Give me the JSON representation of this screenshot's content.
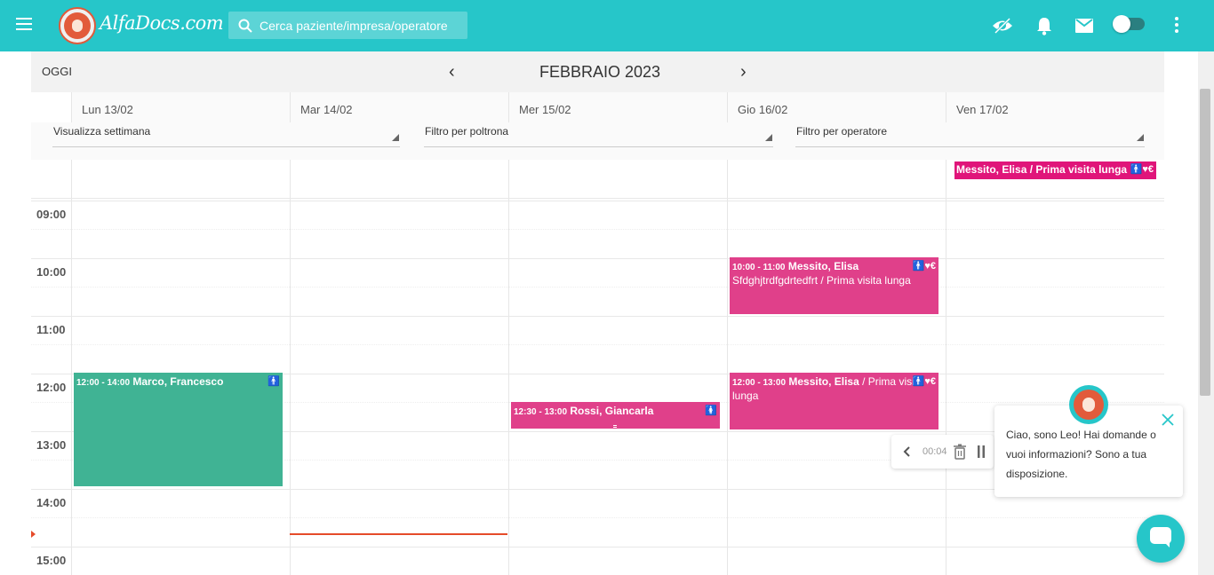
{
  "header": {
    "brand": "AlfaDocs.com",
    "search_placeholder": "Cerca paziente/impresa/operatore"
  },
  "calendar": {
    "today_label": "OGGI",
    "prev_label": "‹",
    "next_label": "›",
    "month_label": "FEBBRAIO 2023",
    "days": [
      "Lun 13/02",
      "Mar 14/02",
      "Mer 15/02",
      "Gio 16/02",
      "Ven 17/02"
    ],
    "filters": {
      "view": "Visualizza settimana",
      "chair": "Filtro per poltrona",
      "operator": "Filtro per operatore"
    },
    "hours": [
      "09:00",
      "10:00",
      "11:00",
      "12:00",
      "13:00",
      "14:00",
      "15:00"
    ],
    "allday_event": {
      "title": "Messito, Elisa / Prima visita lunga",
      "icons": "🚹♥€"
    },
    "events": [
      {
        "time": "10:00 - 11:00",
        "name": "Messito, Elisa",
        "detail": "Sfdghjtrdfgdrtedfrt / Prima visita lunga",
        "icons": "🚹♥€"
      },
      {
        "time": "12:00 - 14:00",
        "name": "Marco, Francesco",
        "detail": "",
        "icons": "🚹"
      },
      {
        "time": "12:30 - 13:00",
        "name": "Rossi, Giancarla",
        "detail": "",
        "icons": "🚺"
      },
      {
        "time": "12:00 - 13:00",
        "name": "Messito, Elisa",
        "detail": " / Prima visita lunga",
        "icons": "🚹♥€"
      }
    ],
    "colors": {
      "teal": "#40b394",
      "pink": "#e0408a",
      "magenta": "#e0157a",
      "now": "#e54b2a"
    }
  },
  "recorder": {
    "time": "00:04"
  },
  "chat": {
    "message": "Ciao, sono Leo! Hai domande o vuoi informazioni? Sono a tua disposizione."
  }
}
